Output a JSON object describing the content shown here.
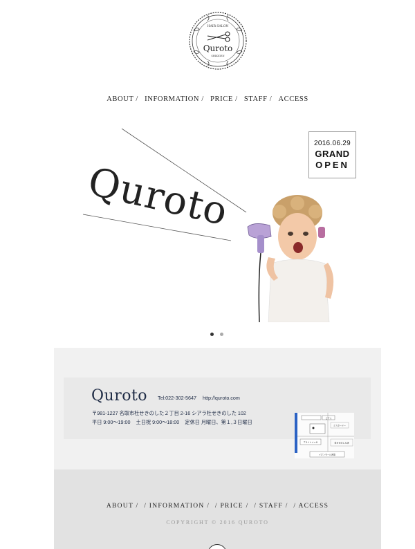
{
  "header": {
    "logo": {
      "icon": "scissors-icon",
      "top_text": "HAIR SALON",
      "name": "Quroto",
      "bottom_text": "SHIKIGEN"
    }
  },
  "top_nav": {
    "items": [
      {
        "label": "ABOUT /"
      },
      {
        "label": "INFORMATION /"
      },
      {
        "label": "PRICE /"
      },
      {
        "label": "STAFF /"
      },
      {
        "label": "ACCESS"
      }
    ]
  },
  "hero": {
    "title": "Quroto",
    "announcement": {
      "date": "2016.06.29",
      "line1": "GRAND",
      "line2": "OPEN"
    },
    "slide_count": 2,
    "active_slide": 1
  },
  "shop_info": {
    "name": "Quroto",
    "tel": "Tel:022-302-5647",
    "url": "http://quroto.com",
    "address": "〒981-1227 名取市杜せきのした２丁目 2-16 シアラ杜せきのした 102",
    "hours_weekday": "平日 9:00〜19:00",
    "hours_weekend": "土日祝 9:00〜18:00",
    "holiday": "定休日 月曜日、第１,３日曜日",
    "map_labels": {
      "top_tag": "ピアス",
      "right_tag": "ミスタードー",
      "left_tag": "ブライトメッセ",
      "right_bottom_tag": "杜せきのした店",
      "bottom_tag": "イオンモール名取"
    }
  },
  "footer": {
    "nav": [
      {
        "label": "ABOUT /"
      },
      {
        "label": "/ INFORMATION /"
      },
      {
        "label": "/ PRICE /"
      },
      {
        "label": "/ STAFF /"
      },
      {
        "label": "/ ACCESS"
      }
    ],
    "copyright": "COPYRIGHT © 2016 QUROTO"
  },
  "colors": {
    "text": "#222222",
    "navy": "#1e2b45",
    "info_band": "#f1f1f1",
    "info_card": "#e9e9e9",
    "footer": "#e2e2e2",
    "dot_active": "#333333",
    "dot_inactive": "#aaaaaa"
  }
}
